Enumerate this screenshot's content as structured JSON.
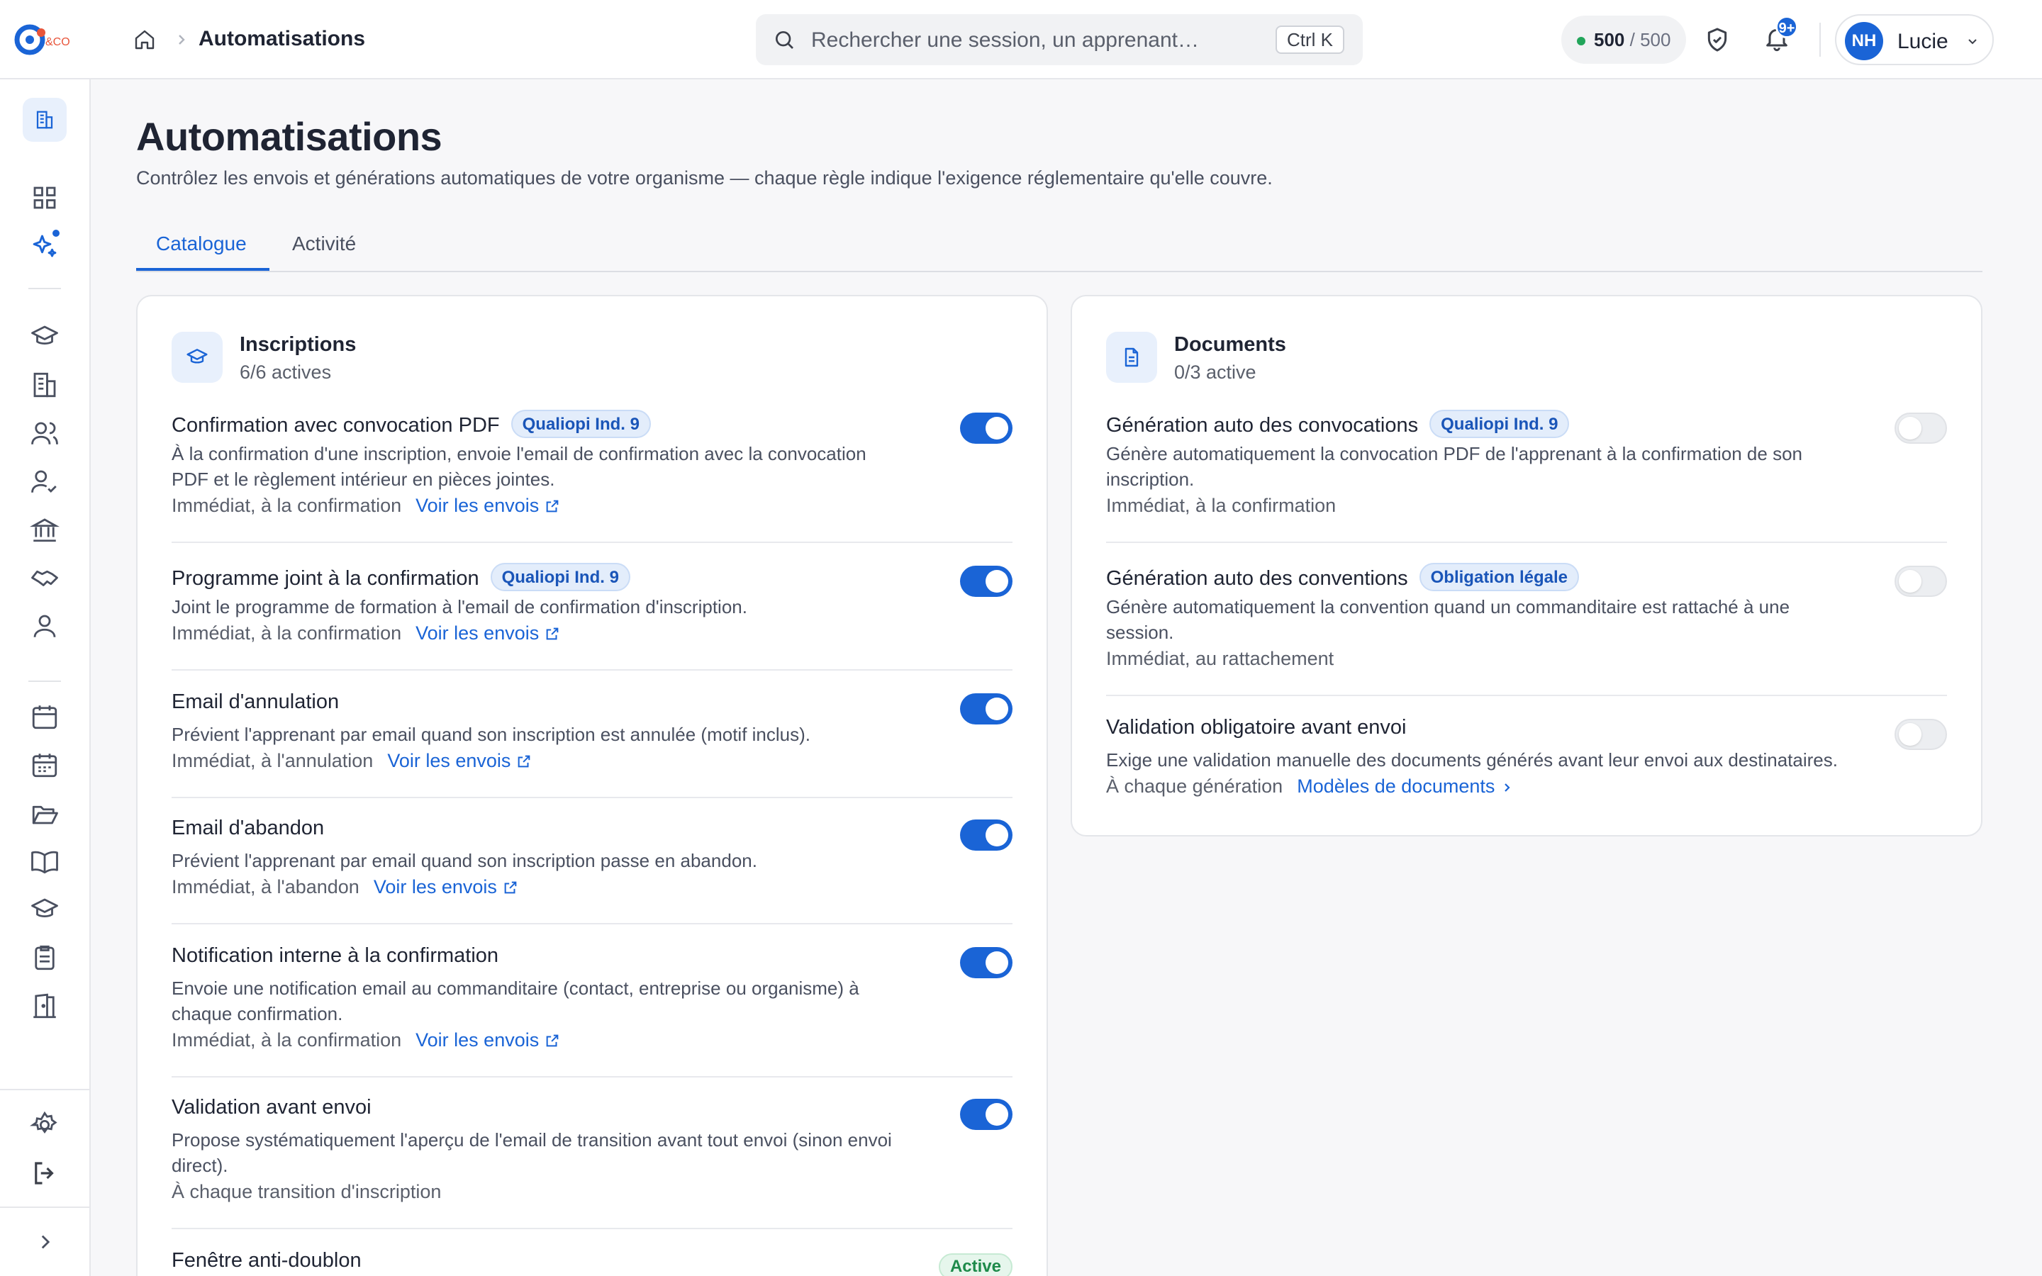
{
  "header": {
    "breadcrumb_title": "Automatisations",
    "search_placeholder": "Rechercher une session, un apprenant…",
    "search_shortcut": "Ctrl K",
    "credits_used": "500",
    "credits_total": "/ 500",
    "notification_badge": "9+",
    "user_initials": "NH",
    "user_name": "Lucie",
    "logo_text": "&CO"
  },
  "sidebar": {
    "items": [
      "dashboard",
      "grid",
      "automations",
      "courses",
      "buildings",
      "learners",
      "trainers",
      "funders",
      "partners",
      "contacts",
      "calendar",
      "planning",
      "folders",
      "library",
      "graduation",
      "checklist",
      "rooms",
      "settings",
      "logout",
      "expand"
    ]
  },
  "page": {
    "title": "Automatisations",
    "subtitle": "Contrôlez les envois et générations automatiques de votre organisme — chaque règle indique l'exigence réglementaire qu'elle couvre.",
    "tabs": [
      "Catalogue",
      "Activité"
    ]
  },
  "inscriptions": {
    "title": "Inscriptions",
    "count": "6/6 actives",
    "rules": [
      {
        "title": "Confirmation avec convocation PDF",
        "tag": "Qualiopi Ind. 9",
        "desc1": "À la confirmation d'une inscription, envoie l'email de confirmation avec la convocation",
        "desc2": "PDF et le règlement intérieur en pièces jointes.",
        "meta": "Immédiat, à la confirmation",
        "link": "Voir les envois"
      },
      {
        "title": "Programme joint à la confirmation",
        "tag": "Qualiopi Ind. 9",
        "desc1": "Joint le programme de formation à l'email de confirmation d'inscription.",
        "meta": "Immédiat, à la confirmation",
        "link": "Voir les envois"
      },
      {
        "title": "Email d'annulation",
        "desc1": "Prévient l'apprenant par email quand son inscription est annulée (motif inclus).",
        "meta": "Immédiat, à l'annulation",
        "link": "Voir les envois"
      },
      {
        "title": "Email d'abandon",
        "desc1": "Prévient l'apprenant par email quand son inscription passe en abandon.",
        "meta": "Immédiat, à l'abandon",
        "link": "Voir les envois"
      },
      {
        "title": "Notification interne à la confirmation",
        "desc1": "Envoie une notification email au commanditaire (contact, entreprise ou organisme) à",
        "desc2": "chaque confirmation.",
        "meta": "Immédiat, à la confirmation",
        "link": "Voir les envois"
      },
      {
        "title": "Validation avant envoi",
        "desc1": "Propose systématiquement l'aperçu de l'email de transition avant tout envoi (sinon envoi",
        "desc2": "direct).",
        "meta": "À chaque transition d'inscription"
      },
      {
        "title": "Fenêtre anti-doublon",
        "status": "Active"
      }
    ]
  },
  "documents": {
    "title": "Documents",
    "count": "0/3 active",
    "rules": [
      {
        "title": "Génération auto des convocations",
        "tag": "Qualiopi Ind. 9",
        "desc1": "Génère automatiquement la convocation PDF de l'apprenant à la confirmation de son",
        "desc2": "inscription.",
        "meta": "Immédiat, à la confirmation"
      },
      {
        "title": "Génération auto des conventions",
        "tag": "Obligation légale",
        "desc1": "Génère automatiquement la convention quand un commanditaire est rattaché à une",
        "desc2": "session.",
        "meta": "Immédiat, au rattachement"
      },
      {
        "title": "Validation obligatoire avant envoi",
        "desc1": "Exige une validation manuelle des documents générés avant leur envoi aux destinataires.",
        "meta": "À chaque génération",
        "link": "Modèles de documents"
      }
    ]
  },
  "colors": {
    "accent": "#1a64d6",
    "toggle_off": "#eceef1",
    "tag_bg": "#e3edfb",
    "active_green": "#1e8a4a"
  }
}
